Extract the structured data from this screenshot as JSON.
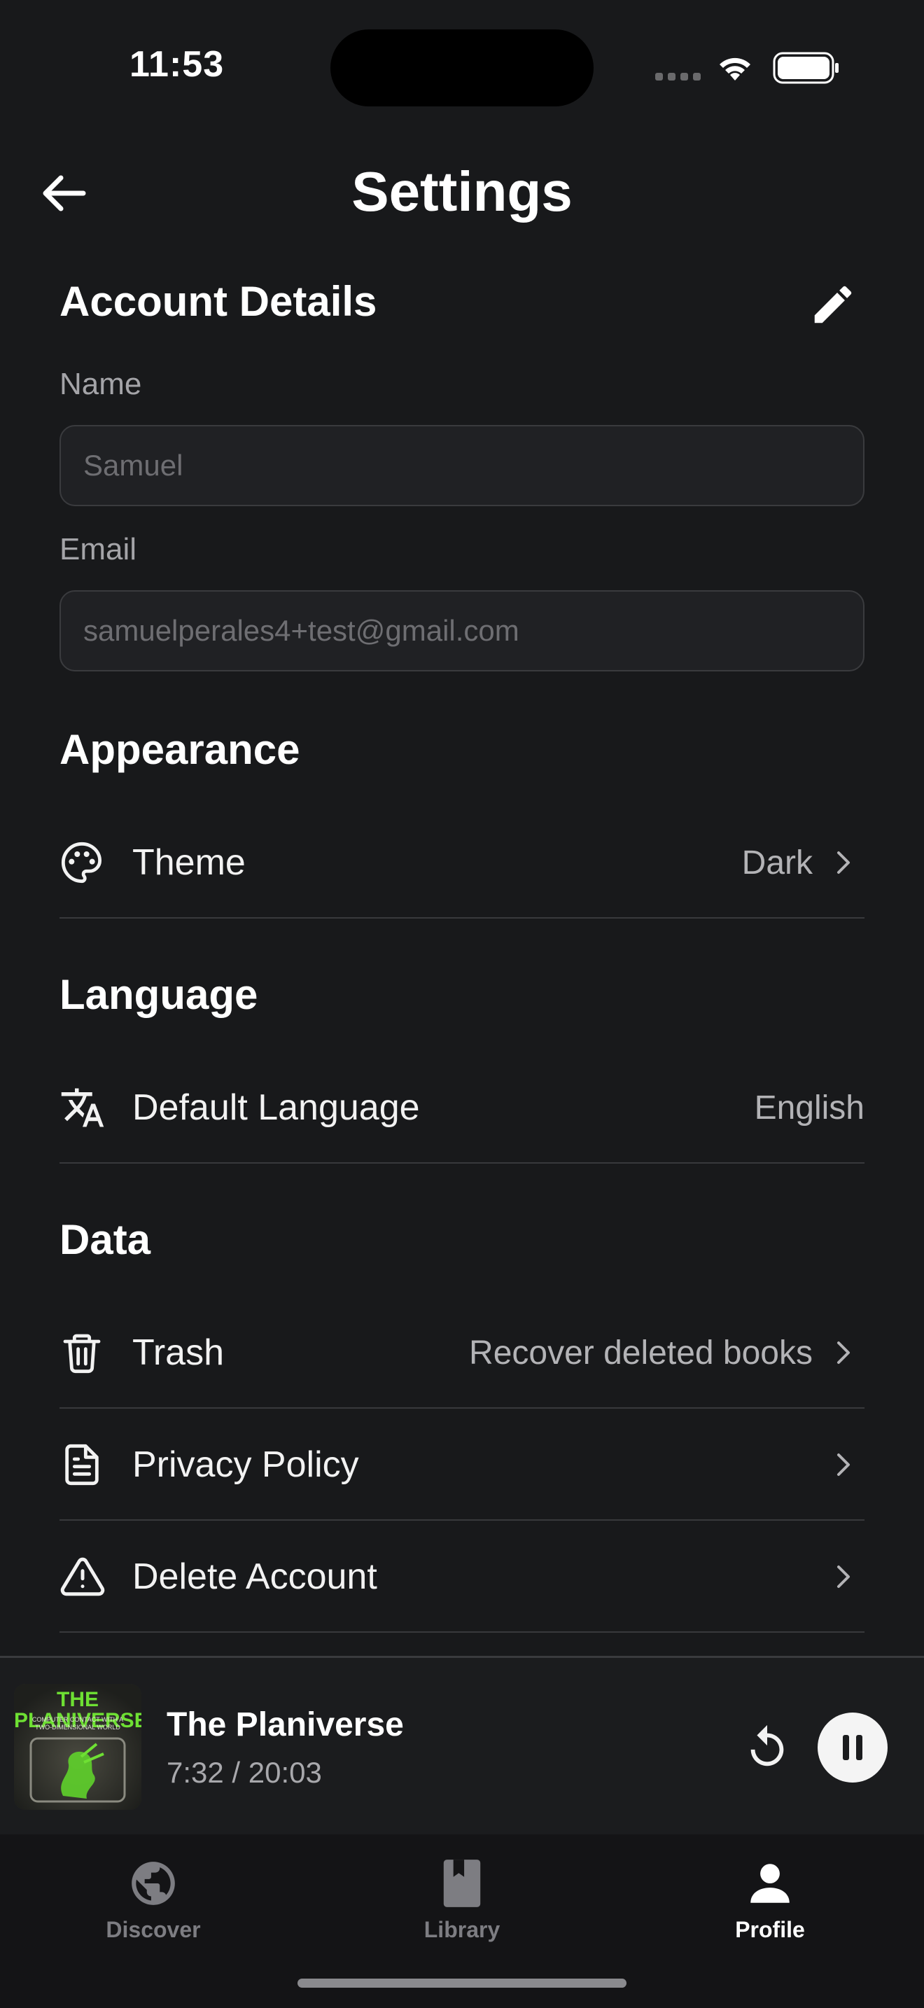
{
  "status_bar": {
    "time": "11:53"
  },
  "header": {
    "title": "Settings"
  },
  "account": {
    "title": "Account Details",
    "name_label": "Name",
    "name_placeholder": "Samuel",
    "email_label": "Email",
    "email_placeholder": "samuelperales4+test@gmail.com"
  },
  "appearance": {
    "title": "Appearance",
    "theme": {
      "icon": "palette-icon",
      "label": "Theme",
      "value": "Dark"
    }
  },
  "language": {
    "title": "Language",
    "default_language": {
      "icon": "translate-icon",
      "label": "Default Language",
      "value": "English"
    }
  },
  "data_section": {
    "title": "Data",
    "items": [
      {
        "icon": "trash-icon",
        "label": "Trash",
        "value": "Recover deleted books"
      },
      {
        "icon": "document-icon",
        "label": "Privacy Policy",
        "value": ""
      },
      {
        "icon": "warning-icon",
        "label": "Delete Account",
        "value": ""
      }
    ]
  },
  "player": {
    "title": "The Planiverse",
    "time": "7:32 / 20:03",
    "cover": {
      "title": "THE PLANIVERSE",
      "subtitle": "COMPUTER CONTACT WITH A TWO-DIMENSIONAL WORLD"
    },
    "is_playing": true
  },
  "tabs": [
    {
      "label": "Discover",
      "icon": "globe-icon",
      "active": false
    },
    {
      "label": "Library",
      "icon": "book-icon",
      "active": false
    },
    {
      "label": "Profile",
      "icon": "person-icon",
      "active": true
    }
  ],
  "colors": {
    "background": "#18191b",
    "input_background": "#202124",
    "divider": "#38393c",
    "accent_green": "#6ee033"
  }
}
